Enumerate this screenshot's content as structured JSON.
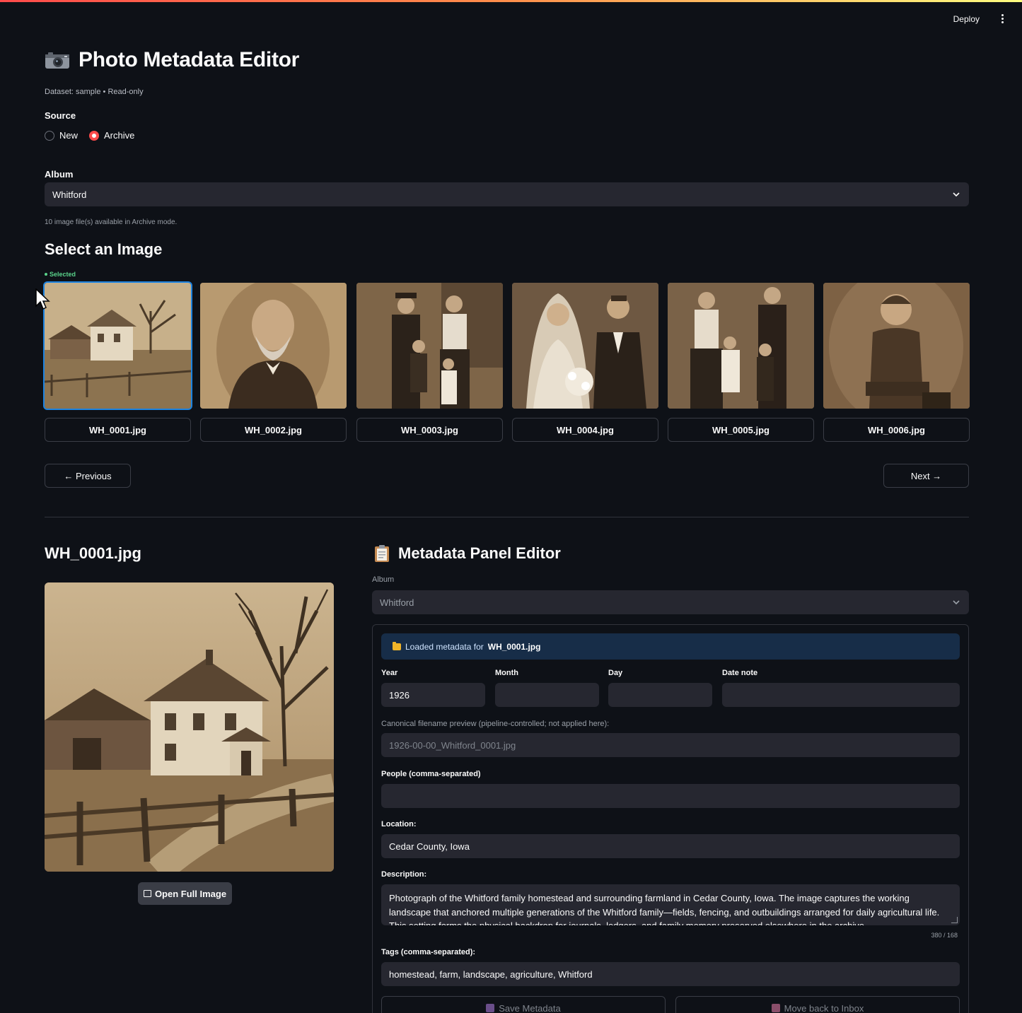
{
  "header": {
    "deploy_label": "Deploy"
  },
  "app": {
    "title": "Photo Metadata Editor",
    "subtitle": "Dataset: sample • Read-only"
  },
  "source": {
    "label": "Source",
    "options": [
      "New",
      "Archive"
    ],
    "selected": "Archive"
  },
  "album": {
    "label": "Album",
    "value": "Whitford",
    "availability_note": "10 image file(s) available in Archive mode."
  },
  "gallery": {
    "heading": "Select an Image",
    "selected_tag": "Selected",
    "items": [
      {
        "filename": "WH_0001.jpg",
        "selected": true
      },
      {
        "filename": "WH_0002.jpg",
        "selected": false
      },
      {
        "filename": "WH_0003.jpg",
        "selected": false
      },
      {
        "filename": "WH_0004.jpg",
        "selected": false
      },
      {
        "filename": "WH_0005.jpg",
        "selected": false
      },
      {
        "filename": "WH_0006.jpg",
        "selected": false
      }
    ],
    "previous_label": "← Previous",
    "next_label": "Next →"
  },
  "preview": {
    "filename": "WH_0001.jpg",
    "open_full_label": "Open Full Image"
  },
  "metadata": {
    "heading": "Metadata Panel Editor",
    "album_label": "Album",
    "album_value": "Whitford",
    "banner_prefix": "Loaded metadata for",
    "banner_file": "WH_0001.jpg",
    "year_label": "Year",
    "year_value": "1926",
    "month_label": "Month",
    "month_value": "",
    "day_label": "Day",
    "day_value": "",
    "date_note_label": "Date note",
    "date_note_value": "",
    "canonical_label": "Canonical filename preview (pipeline-controlled; not applied here):",
    "canonical_value": "1926-00-00_Whitford_0001.jpg",
    "people_label": "People (comma-separated)",
    "people_value": "",
    "location_label": "Location:",
    "location_value": "Cedar County, Iowa",
    "description_label": "Description:",
    "description_value": "Photograph of the Whitford family homestead and surrounding farmland in Cedar County, Iowa. The image captures the working landscape that anchored multiple generations of the Whitford family—fields, fencing, and outbuildings arranged for daily agricultural life. This setting forms the physical backdrop for journals, ledgers, and family memory preserved elsewhere in the archive.",
    "description_count": "380 / 168",
    "tags_label": "Tags (comma-separated):",
    "tags_value": "homestead, farm, landscape, agriculture, Whitford",
    "save_label": "Save Metadata",
    "move_label": "Move back to Inbox"
  },
  "colors": {
    "background": "#0e1117",
    "accent": "#ff4b4b",
    "selection": "#1c83e1",
    "sepia": "#8a6a45"
  }
}
